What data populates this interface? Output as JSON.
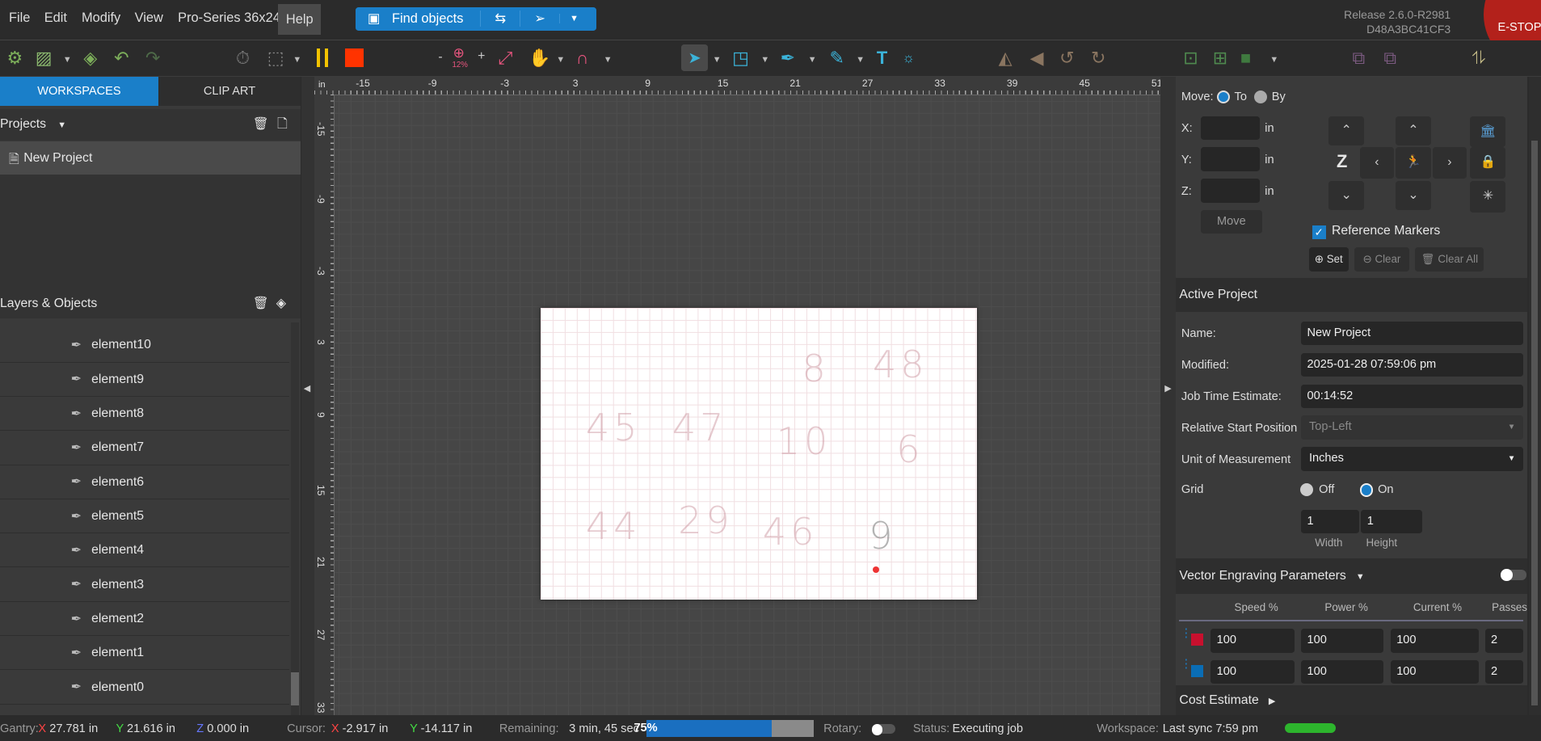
{
  "menu": [
    "File",
    "Edit",
    "Modify",
    "View",
    "Pro-Series 36x24",
    "Help"
  ],
  "find": {
    "label": "Find objects"
  },
  "release": {
    "version": "Release 2.6.0-R2981",
    "id": "D48A3BC41CF3",
    "estop": "E-STOP"
  },
  "toolbar": {
    "zoom": "12%",
    "minus": "-",
    "plus": "+"
  },
  "sidebar": {
    "tabs": [
      "WORKSPACES",
      "CLIP ART"
    ],
    "projects_label": "Projects",
    "project": "New Project",
    "layers_label": "Layers & Objects",
    "items": [
      "element10",
      "element9",
      "element8",
      "element7",
      "element6",
      "element5",
      "element4",
      "element3",
      "element2",
      "element1",
      "element0"
    ]
  },
  "ruler": {
    "unit": "in",
    "top": [
      "-15",
      "-9",
      "-3",
      "3",
      "9",
      "15",
      "21",
      "27",
      "33",
      "39",
      "45",
      "51"
    ],
    "left": [
      "-15",
      "-9",
      "-3",
      "3",
      "9",
      "15",
      "21",
      "27",
      "33"
    ]
  },
  "canvas": {
    "glyphs": [
      "8",
      "48",
      "45",
      "47",
      "10",
      "6",
      "44",
      "29",
      "46",
      "9"
    ]
  },
  "move": {
    "label": "Move:",
    "to": "To",
    "by": "By",
    "x": "X:",
    "y": "Y:",
    "z": "Z:",
    "unit": "in",
    "button": "Move",
    "zaxis": "Z",
    "ref": "Reference Markers",
    "set": "Set",
    "clear": "Clear",
    "clear_all": "Clear All"
  },
  "project": {
    "title": "Active Project",
    "name_l": "Name:",
    "name": "New Project",
    "mod_l": "Modified:",
    "mod": "2025-01-28 07:59:06 pm",
    "jt_l": "Job Time Estimate:",
    "jt": "00:14:52",
    "rsp_l": "Relative Start Position",
    "rsp": "Top-Left",
    "uom_l": "Unit of Measurement",
    "uom": "Inches",
    "grid_l": "Grid",
    "off": "Off",
    "on": "On",
    "gw": "1",
    "gh": "1",
    "w_l": "Width",
    "h_l": "Height"
  },
  "vector": {
    "title": "Vector Engraving Parameters",
    "cols": [
      "Speed %",
      "Power %",
      "Current %",
      "Passes"
    ],
    "rows": [
      {
        "color": "#c8102e",
        "speed": "100",
        "power": "100",
        "current": "100",
        "passes": "2"
      },
      {
        "color": "#0a6db5",
        "speed": "100",
        "power": "100",
        "current": "100",
        "passes": "2"
      }
    ]
  },
  "cost": {
    "title": "Cost Estimate"
  },
  "status": {
    "gantry": "Gantry:",
    "gx": "X 27.781 in",
    "gy": "Y 21.616 in",
    "gz": "Z 0.000 in",
    "cursor": "Cursor:",
    "cx": "X -2.917 in",
    "cy": "Y -14.117 in",
    "remaining_l": "Remaining:",
    "remaining": "3 min, 45 sec",
    "progress": "75%",
    "progress_value": 75,
    "rotary": "Rotary:",
    "status_l": "Status:",
    "status": "Executing job",
    "ws_l": "Workspace:",
    "ws": "Last sync 7:59 pm"
  },
  "colors": {
    "accent": "#1a7fc9",
    "estop": "#b3211b",
    "ok": "#2db52d"
  }
}
